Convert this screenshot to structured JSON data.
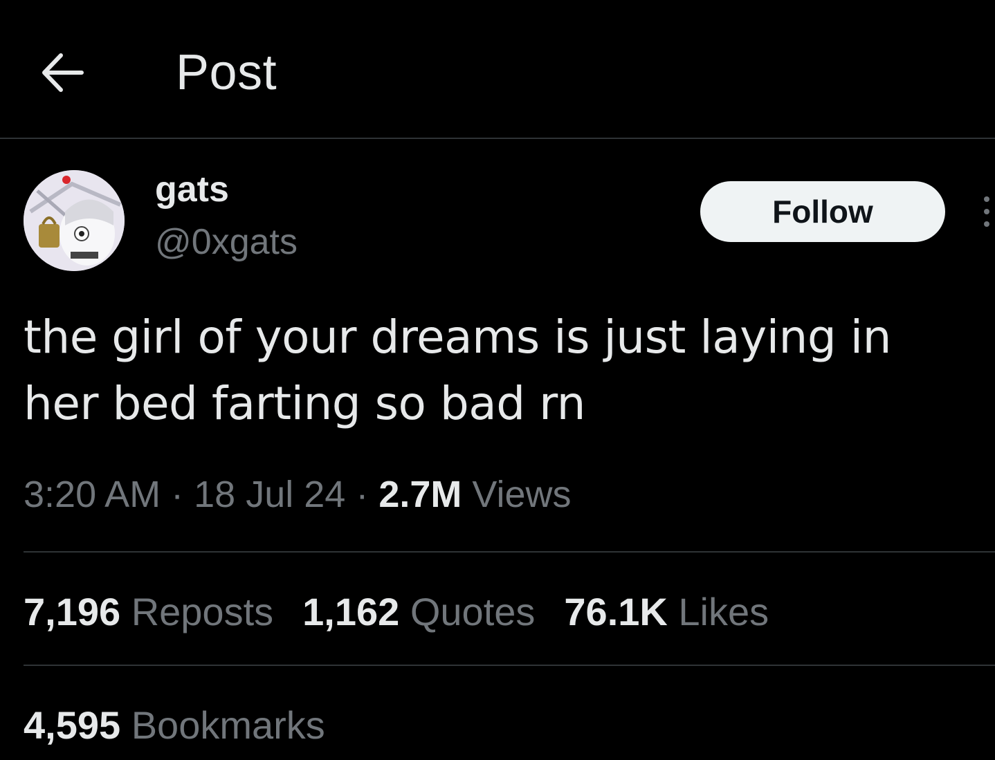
{
  "header": {
    "back_icon": "arrow-left-icon",
    "title": "Post"
  },
  "author": {
    "display_name": "gats",
    "handle": "@0xgats",
    "avatar_icon": "avatar-anime-character"
  },
  "follow_button": {
    "label": "Follow"
  },
  "more_icon": "more-vertical-icon",
  "tweet": {
    "text_line1": "the girl of your dreams is just laying in",
    "text_line2": "her bed farting so bad rn"
  },
  "meta": {
    "time": "3:20 AM",
    "separator": "·",
    "date": "18 Jul 24",
    "views_count": "2.7M",
    "views_label": "Views"
  },
  "stats": {
    "reposts_count": "7,196",
    "reposts_label": "Reposts",
    "quotes_count": "1,162",
    "quotes_label": "Quotes",
    "likes_count": "76.1K",
    "likes_label": "Likes",
    "bookmarks_count": "4,595",
    "bookmarks_label": "Bookmarks"
  },
  "colors": {
    "background": "#000000",
    "text_primary": "#e7e9ea",
    "text_secondary": "#71767b",
    "divider": "#2f3336",
    "follow_bg": "#eff3f4",
    "follow_text": "#0f1419"
  }
}
